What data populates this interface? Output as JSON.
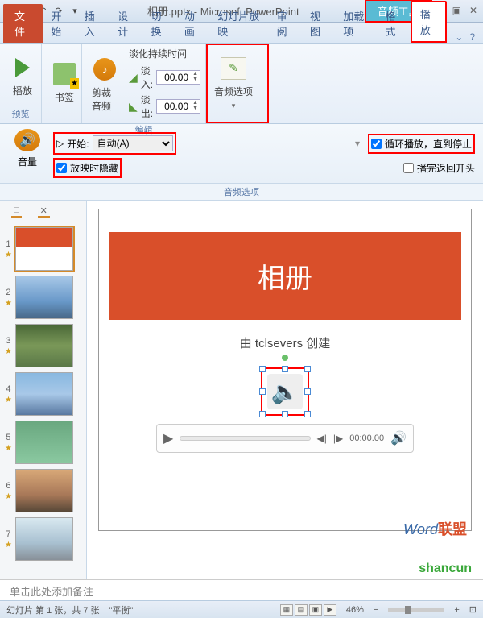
{
  "title": "相册.pptx - Microsoft PowerPoint",
  "context_tab": "音频工具",
  "win": {
    "min": "⎯",
    "max": "▣",
    "close": "✕"
  },
  "tabs": {
    "file": "文件",
    "home": "开始",
    "insert": "插入",
    "design": "设计",
    "transitions": "切换",
    "animations": "动画",
    "slideshow": "幻灯片放映",
    "review": "审阅",
    "view": "视图",
    "addins": "加载项",
    "format": "格式",
    "playback": "播放"
  },
  "ribbon": {
    "preview": {
      "play": "播放",
      "group": "预览"
    },
    "bookmarks": {
      "btn": "书签"
    },
    "trim": {
      "btn": "剪裁音频"
    },
    "fade": {
      "title": "淡化持续时间",
      "in_label": "淡入:",
      "in_val": "00.00",
      "out_label": "淡出:",
      "out_val": "00.00"
    },
    "edit_group": "编辑",
    "audio_options": "音频选项"
  },
  "opts": {
    "volume": "音量",
    "start_icon": "▷",
    "start_label": "开始:",
    "start_value": "自动(A)",
    "loop": "循环播放，直到停止",
    "hide": "放映时隐藏",
    "rewind": "播完返回开头",
    "group": "音频选项"
  },
  "thumbs": {
    "tab1": "□",
    "tab2": "✕",
    "items": [
      {
        "n": "1"
      },
      {
        "n": "2"
      },
      {
        "n": "3"
      },
      {
        "n": "4"
      },
      {
        "n": "5"
      },
      {
        "n": "6"
      },
      {
        "n": "7"
      }
    ]
  },
  "slide": {
    "title": "相册",
    "subtitle": "由 tclsevers 创建",
    "player_time": "00:00.00"
  },
  "notes": "单击此处添加备注",
  "status": {
    "slide": "幻灯片 第 1 张，共 7 张",
    "theme": "\"平衡\"",
    "zoom": "46%"
  },
  "watermark": {
    "w": "Word",
    "l": "联盟"
  },
  "shancun": "shancun"
}
